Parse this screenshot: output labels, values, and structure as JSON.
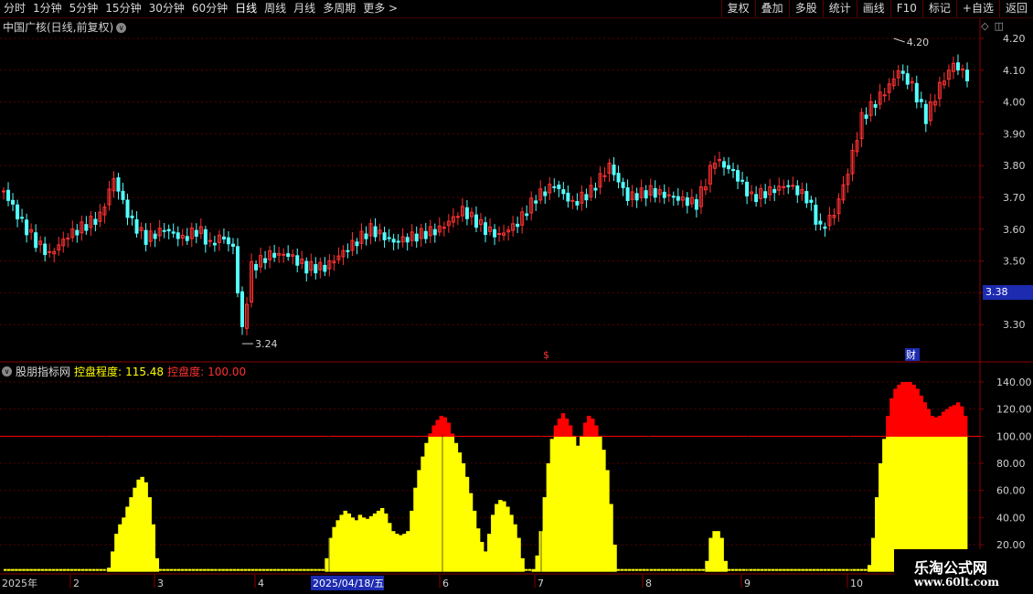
{
  "toolbar": {
    "left": [
      "分时",
      "1分钟",
      "5分钟",
      "15分钟",
      "30分钟",
      "60分钟",
      "日线",
      "周线",
      "月线",
      "多周期",
      "更多 >"
    ],
    "active": "日线",
    "right": [
      "复权",
      "叠加",
      "多股",
      "统计",
      "画线",
      "F10",
      "标记",
      "+自选",
      "返回"
    ]
  },
  "chart": {
    "title": "中国广核(日线,前复权)",
    "price_axis": [
      "4.20",
      "4.10",
      "4.00",
      "3.90",
      "3.80",
      "3.70",
      "3.60",
      "3.50",
      "3.40",
      "3.30"
    ],
    "current_price": "3.38",
    "high_label": "4.20",
    "low_label": "3.24",
    "markers": {
      "dollar": "$",
      "cai": "财"
    }
  },
  "indicator": {
    "source": "股朋指标网",
    "name1": "控盘程度:",
    "value1": "115.48",
    "name2": "控盘度:",
    "value2": "100.00",
    "axis": [
      "140.00",
      "120.00",
      "100.00",
      "80.00",
      "60.00",
      "40.00",
      "20.00"
    ]
  },
  "date_axis": {
    "labels": [
      "2025年",
      "2",
      "3",
      "4",
      "2025/04/18/五",
      "6",
      "7",
      "8",
      "9",
      "10"
    ]
  },
  "watermark": {
    "line1": "乐淘公式网",
    "line2": "www.60lt.com"
  },
  "colors": {
    "up": "#ff3232",
    "down": "#54ffff",
    "grid": "#5a0000",
    "yellow": "#ffff00",
    "red": "#ff0000",
    "axis_bg": "#000000"
  },
  "chart_data": {
    "type": "bar",
    "title": "",
    "ylim": [
      0,
      145
    ],
    "series": [
      {
        "name": "控盘程度",
        "values": [
          0,
          0,
          0,
          0,
          0,
          0,
          0,
          0,
          0,
          0,
          0,
          0,
          0,
          0,
          0,
          0,
          0,
          0,
          0,
          0,
          0,
          0,
          0,
          0,
          0,
          0,
          0,
          0,
          3,
          15,
          28,
          35,
          40,
          48,
          55,
          62,
          68,
          70,
          66,
          55,
          35,
          10,
          0,
          0,
          0,
          0,
          0,
          0,
          0,
          0,
          0,
          0,
          0,
          0,
          0,
          0,
          0,
          0,
          0,
          0,
          0,
          0,
          0,
          0,
          0,
          0,
          0,
          0,
          0,
          0,
          0,
          0,
          0,
          0,
          0,
          0,
          0,
          0,
          0,
          0,
          0,
          0,
          0,
          0,
          0,
          0,
          0,
          10,
          25,
          33,
          38,
          42,
          45,
          43,
          40,
          38,
          42,
          40,
          39,
          41,
          43,
          45,
          47,
          43,
          36,
          30,
          28,
          27,
          28,
          30,
          45,
          62,
          75,
          85,
          95,
          102,
          108,
          112,
          115,
          114,
          110,
          102,
          95,
          88,
          80,
          70,
          58,
          45,
          32,
          22,
          15,
          28,
          42,
          50,
          53,
          52,
          48,
          42,
          35,
          25,
          10,
          0,
          0,
          2,
          12,
          30,
          55,
          80,
          98,
          108,
          113,
          117,
          113,
          108,
          100,
          93,
          100,
          110,
          115,
          113,
          108,
          100,
          90,
          75,
          50,
          20,
          0,
          0,
          0,
          0,
          0,
          0,
          0,
          0,
          0,
          0,
          0,
          0,
          0,
          0,
          0,
          0,
          0,
          0,
          0,
          0,
          0,
          0,
          0,
          0,
          8,
          25,
          30,
          30,
          25,
          8,
          0,
          0,
          0,
          0,
          0,
          0,
          0,
          0,
          0,
          0,
          0,
          0,
          0,
          0,
          0,
          0,
          0,
          0,
          0,
          0,
          0,
          0,
          0,
          0,
          0,
          0,
          0,
          0,
          0,
          0,
          0,
          0,
          0,
          0,
          0,
          0,
          0,
          0,
          5,
          25,
          55,
          80,
          98,
          115,
          128,
          135,
          138,
          140,
          140,
          140,
          138,
          135,
          130,
          125,
          120,
          115,
          114,
          115,
          118,
          120,
          122,
          123,
          125,
          122,
          115
        ]
      }
    ],
    "threshold": 100
  }
}
